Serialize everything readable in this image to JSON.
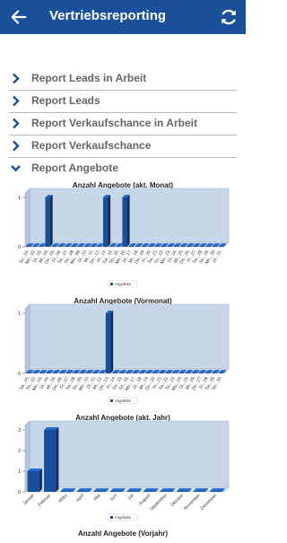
{
  "header": {
    "title": "Vertriebsreporting",
    "back_icon": "arrow-left-icon",
    "refresh_icon": "refresh-icon",
    "color": "#1a4f9a"
  },
  "sections": [
    {
      "label": "Report Leads in Arbeit",
      "expanded": false
    },
    {
      "label": "Report Leads",
      "expanded": false
    },
    {
      "label": "Report Verkaufschance in Arbeit",
      "expanded": false
    },
    {
      "label": "Report Verkaufschance",
      "expanded": false
    },
    {
      "label": "Report Angebote",
      "expanded": true
    }
  ],
  "chart_data": [
    {
      "type": "bar",
      "title": "Anzahl Angebote (akt. Monat)",
      "categories": [
        "So., 01.",
        "Mo., 02.",
        "Di., 03.",
        "Mi., 04.",
        "Do., 05.",
        "Fr., 06.",
        "Sa., 07.",
        "So., 08.",
        "Mo., 09.",
        "Di., 10.",
        "Mi., 11.",
        "Do., 12.",
        "Fr., 13.",
        "Sa., 14.",
        "So., 15.",
        "Mo., 16.",
        "Di., 17.",
        "Mi., 18.",
        "Do., 19.",
        "Fr., 20.",
        "Sa., 21.",
        "So., 22.",
        "Mo., 23.",
        "Di., 24.",
        "Mi., 25.",
        "Do., 26.",
        "Fr., 27.",
        "Sa., 28.",
        "So., 29.",
        "Mo., 30.",
        "Di., 31."
      ],
      "series": [
        {
          "name": "Angebote",
          "values": [
            0,
            0,
            0,
            1,
            0,
            0,
            0,
            0,
            0,
            0,
            0,
            0,
            1,
            0,
            0,
            1,
            0,
            0,
            0,
            0,
            0,
            0,
            0,
            0,
            0,
            0,
            0,
            0,
            0,
            0,
            0
          ]
        }
      ],
      "ylim": [
        0,
        1
      ],
      "yticks": [
        0,
        1
      ],
      "color": "#1a4f9a",
      "plot_bg": "#c7d7e8",
      "legend": "bottom"
    },
    {
      "type": "bar",
      "title": "Anzahl Angebote (Vormonat)",
      "categories": [
        "Sa., 01.",
        "So., 02.",
        "Mo., 03.",
        "Di., 04.",
        "Mi., 05.",
        "Do., 06.",
        "Fr., 07.",
        "Sa., 08.",
        "So., 09.",
        "Mo., 10.",
        "Di., 11.",
        "Mi., 12.",
        "Do., 13.",
        "Fr., 14.",
        "Sa., 15.",
        "So., 16.",
        "Mo., 17.",
        "Di., 18.",
        "Mi., 19.",
        "Do., 20.",
        "Fr., 21.",
        "Sa., 22.",
        "So., 23.",
        "Mo., 24.",
        "Di., 25.",
        "Mi., 26.",
        "Do., 27.",
        "Fr., 28.",
        "Sa., 29.",
        "So., 30."
      ],
      "series": [
        {
          "name": "Angebote",
          "values": [
            0,
            0,
            0,
            0,
            0,
            0,
            0,
            0,
            0,
            0,
            0,
            0,
            1,
            0,
            0,
            0,
            0,
            0,
            0,
            0,
            0,
            0,
            0,
            0,
            0,
            0,
            0,
            0,
            0,
            0
          ]
        }
      ],
      "ylim": [
        0,
        1
      ],
      "yticks": [
        0,
        1
      ],
      "color": "#1a4f9a",
      "plot_bg": "#c7d7e8",
      "legend": "bottom"
    },
    {
      "type": "bar",
      "title": "Anzahl Angebote (akt. Jahr)",
      "categories": [
        "Januar",
        "Februar",
        "März",
        "April",
        "Mai",
        "Juni",
        "Juli",
        "August",
        "September",
        "Oktober",
        "November",
        "Dezember"
      ],
      "series": [
        {
          "name": "Angebote",
          "values": [
            1,
            3,
            0,
            0,
            0,
            0,
            0,
            0,
            0,
            0,
            0,
            0
          ]
        }
      ],
      "ylim": [
        0,
        3
      ],
      "yticks": [
        0,
        1,
        2,
        3
      ],
      "color": "#1a4f9a",
      "plot_bg": "#c7d7e8",
      "legend": "bottom"
    }
  ],
  "next_chart_title": "Anzahl Angebote (Vorjahr)"
}
